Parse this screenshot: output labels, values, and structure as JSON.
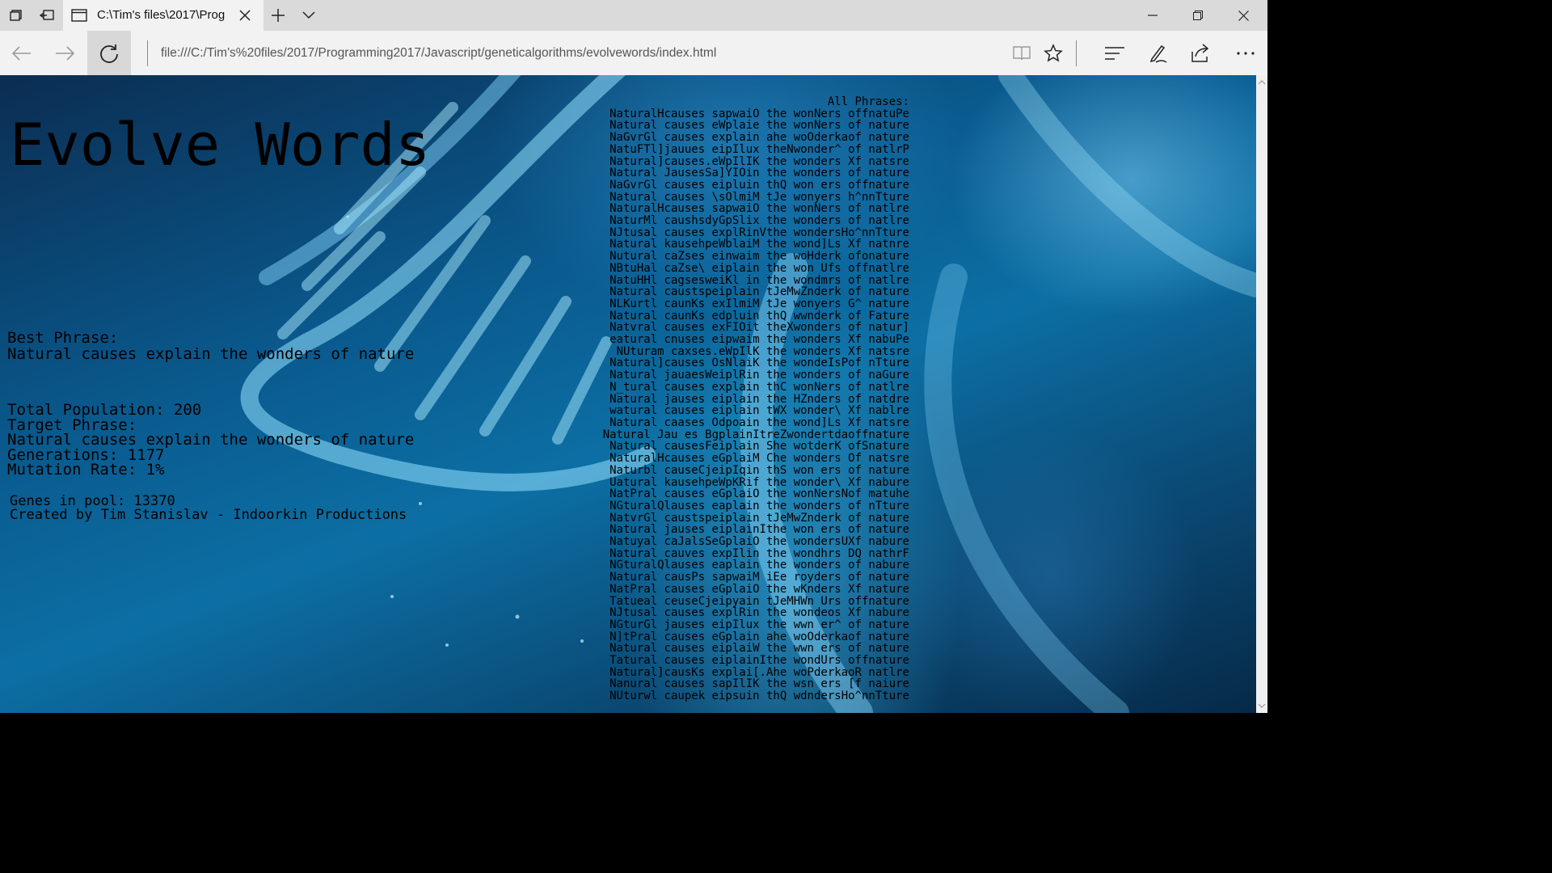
{
  "browser": {
    "tab_title": "C:\\Tim's files\\2017\\Prog",
    "url": "file:///C:/Tim's%20files/2017/Programming2017/Javascript/geneticalgorithms/evolvewords/index.html"
  },
  "page": {
    "title": "Evolve Words",
    "best_label": "Best Phrase:",
    "best_phrase": "Natural causes explain the wonders of nature",
    "total_population": "Total Population: 200",
    "target_label": "Target Phrase:",
    "target_phrase": "Natural causes explain the wonders of nature",
    "generations": "Generations: 1177",
    "mutation_rate": "Mutation Rate: 1%",
    "genes": "Genes in pool: 13370",
    "credit": "Created by Tim Stanislav - Indoorkin Productions",
    "all_label": "All Phrases:",
    "phrases": [
      "NaturalHcauses sapwaiO the wonNers offnatuPe",
      "Natural causes eWplaie the wonNers of nature",
      "NaGvrGl causes explain ahe woOderkaof nature",
      "NatuFTl]jauues eipIlux theNwonder^ of natlrP",
      "Natural]causes.eWpIlIK the wonders Xf natsre",
      "Natural JausesSa]YIOin the wonders of nature",
      "NaGvrGl causes eipluin thQ won ers offnature",
      "Natural causes \\sOlmiM tJe wonyers h^nnTture",
      "NaturalHcauses sapwaiO the wonNers of natlre",
      "NaturMl caushsdyGpSlix the wonders of natlre",
      "NJtusal causes explRinVthe wondersHo^nnTture",
      "Natural kausehpeWblaiM the wond]Ls Xf natnre",
      "Nutural caZses einwaim the woHderk ofonature",
      "NBtuHal caZse\\ eiplain the won Ufs offnatlre",
      "NatuHHl cagsesweiKl in the wondmrs of natlre",
      "Natural caustspeiplain tJeMwZnderk of nature",
      "NLKurtl caunKs exIlmiM tJe wonyers G^ nature",
      "Natural caunKs edpluin thQ wwnderk of Fature",
      "Natvral causes exFIOit theXwonders of natur]",
      "eatural cnuses eipwaim the wonders Xf nabuPe",
      "NUturam caxses.eWpIlK the wonders Xf natsre",
      "Natural]causes OsNlaiK the wondeIsPof nTture",
      "Natural jauaesWeiplRin the wonders of naGure",
      "N_tural causes explain thC wonNers of natlre",
      "Natural jauses eiplain the HZnders of natdre",
      "watural causes eiplain tWX wonder\\ Xf nablre",
      "Natural caases Odpoain the wond]Ls Xf natsre",
      "Natural Jau es BgplainItreZwondertdaoffnature",
      "Natural causesFeiplain She wotderK ofSnature",
      "NaturalHcauses eGplaiM Che wonders Of natsre",
      "Naturbl causeCjeipIqin thS won ers of nature",
      "Uatural kausehpeWpKRif the wonder\\ Xf nabure",
      "NatPral causes eGplaiO the wonNersNof matuhe",
      "NGturalQlauses eaplain the wonders of nTture",
      "NatvrGl caustspeiplain tJeMwZnderk of nature",
      "Natural jauses eiplainIthe won ers of nature",
      "Natuyal caJalsSeGplaiO the wondersUXf nabure",
      "Natural cauves expIlin the wondhrs DQ nathrF",
      "NGturalQlauses eaplain the wonders of nabure",
      "Natural causPs sapwaiM iEe royders of nature",
      "NatPral causes eGplaiO the wKnders Xf nature",
      "Tatueal ceuseCjeipyain tJeMHWn Urs offnature",
      "NJtusal causes explRin the wondeos Xf nabure",
      "NGturGl jauses eipIlux the wwn er^ of nature",
      "N]tPral causes eGplain ahe woOderkaof nature",
      "Natural causes eiplaiW the wwn ers of nature",
      "Tatural causes eiplainIthe wondUrs offnature",
      "Natural]causKs explai[.Ahe woPderkaoR natlre",
      "Nanural causes sapIlIK the wsn ers [f naiure",
      "NUturwl caupek eipsuin thQ wdndersHo^nnTture"
    ]
  }
}
